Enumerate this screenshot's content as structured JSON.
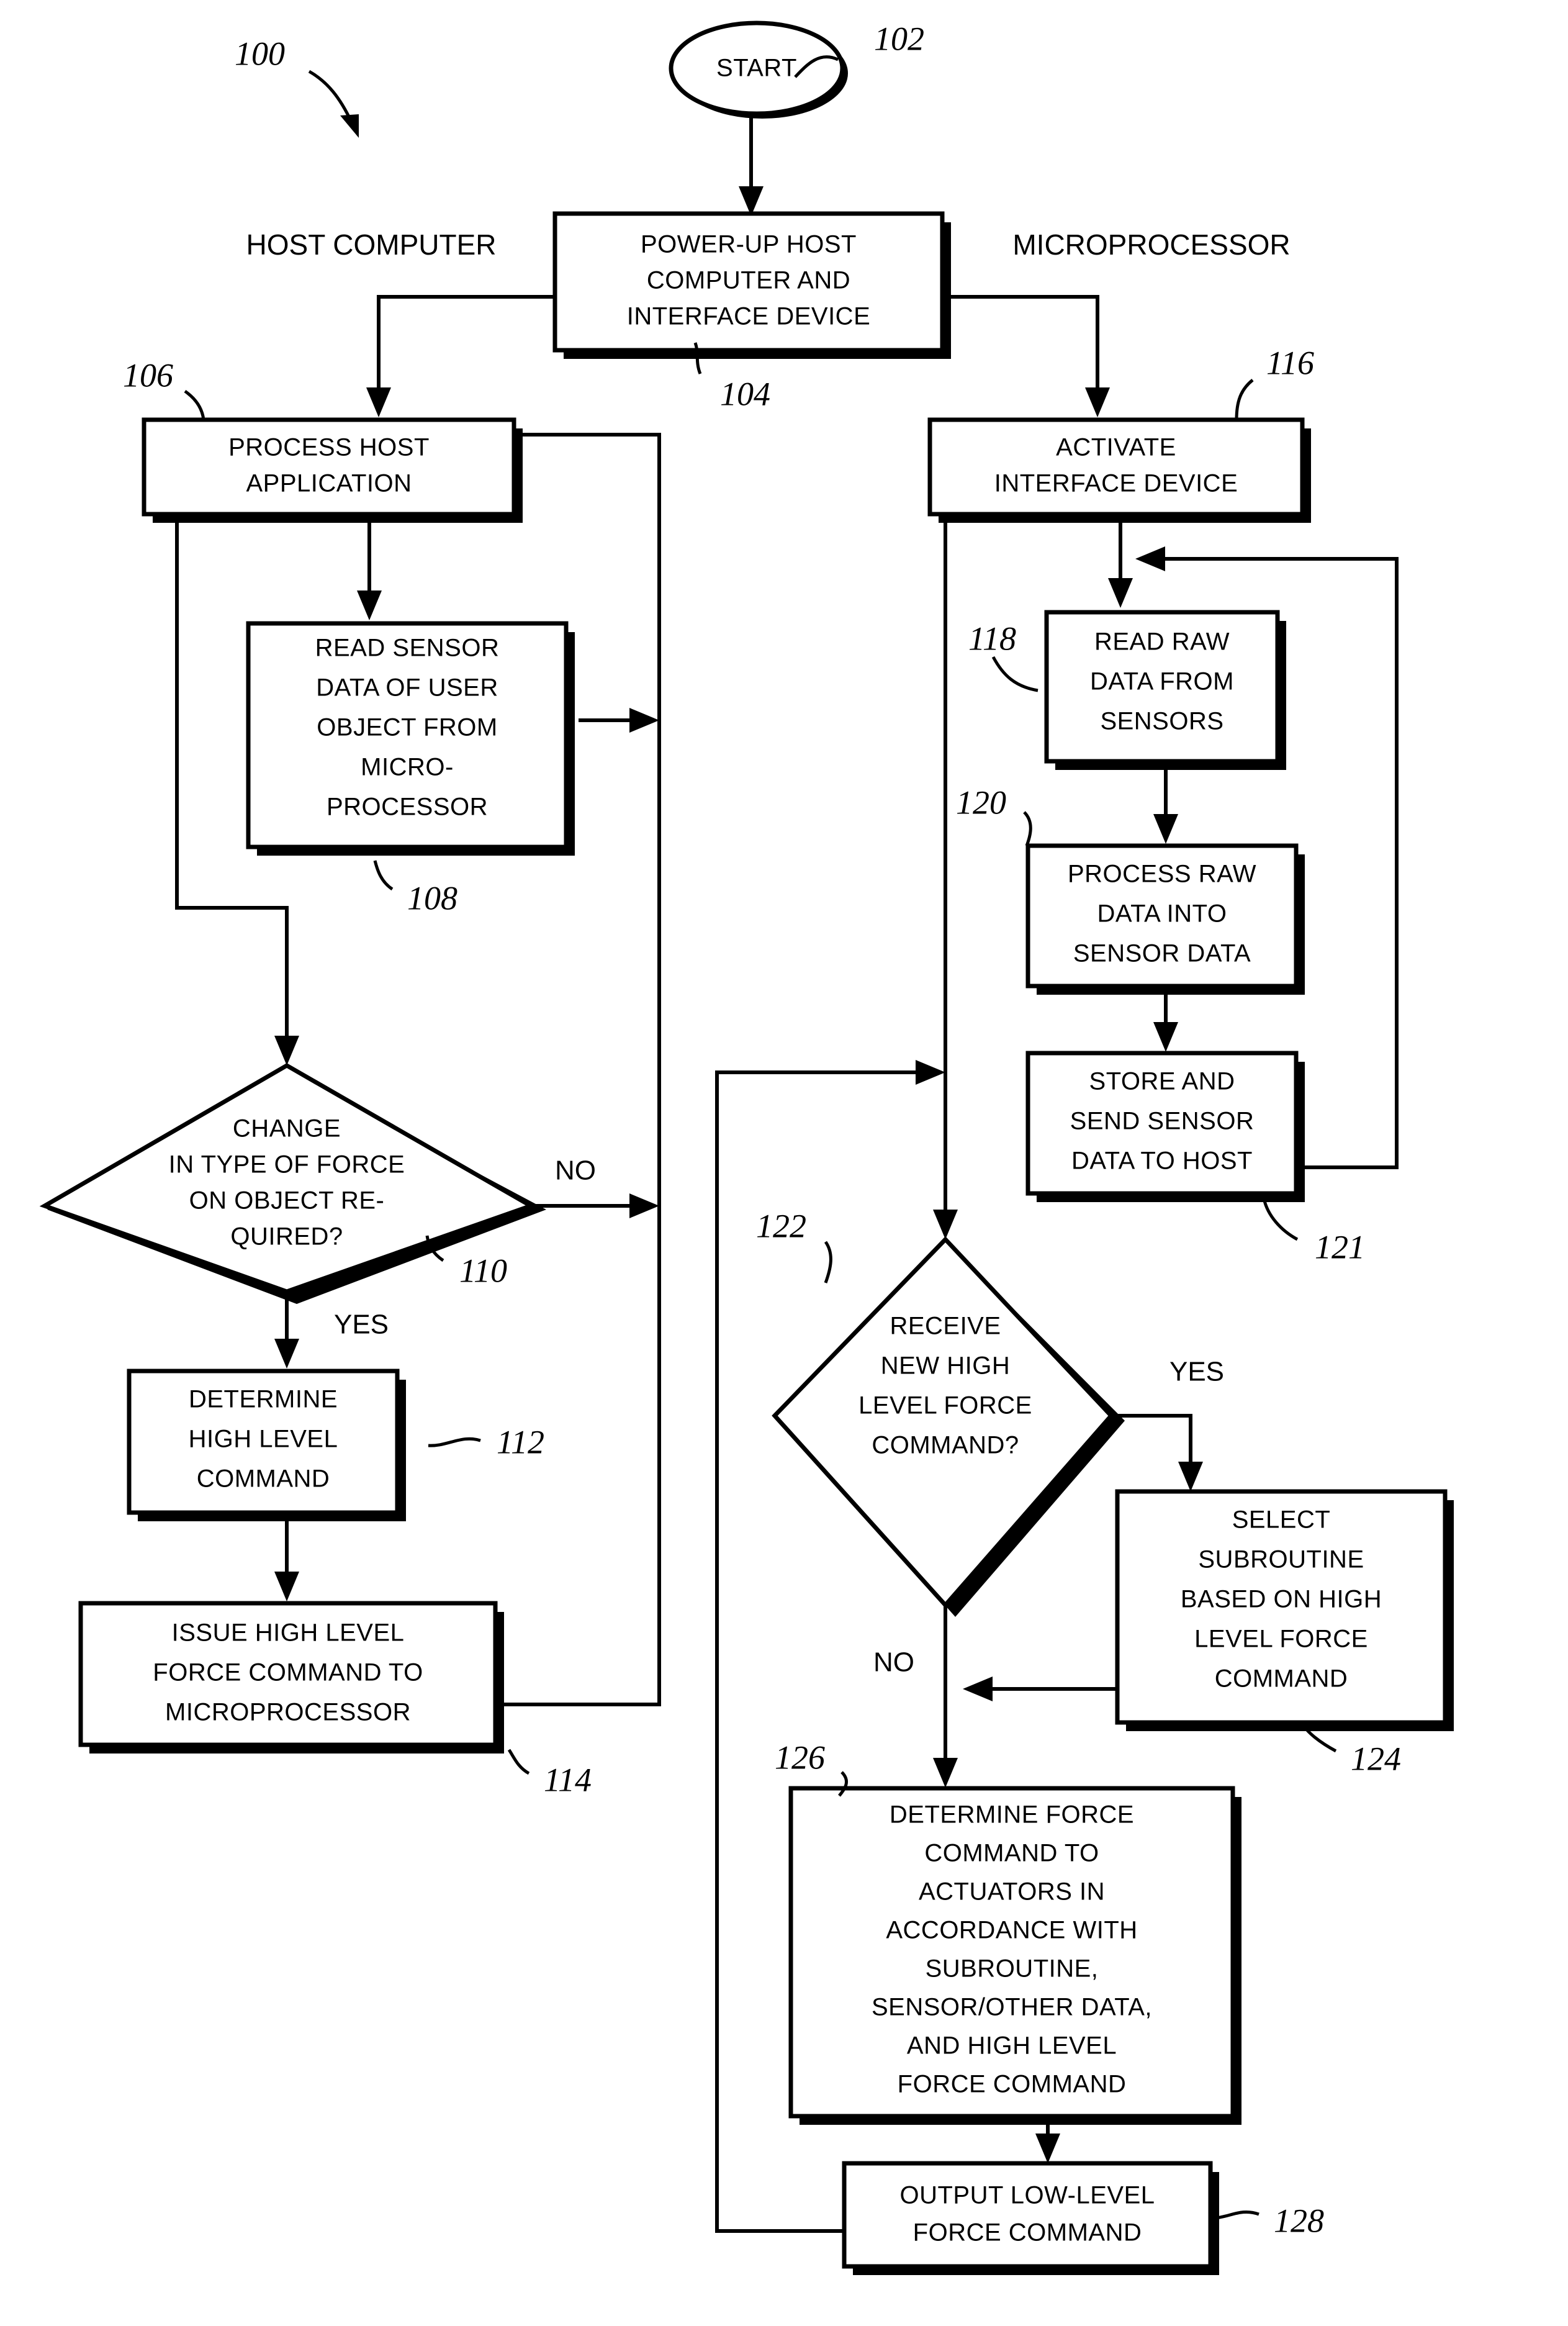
{
  "figure": {
    "reference_numeral": "100",
    "swimlanes": {
      "left_label": "HOST COMPUTER",
      "right_label": "MICROPROCESSOR"
    },
    "branch_labels": {
      "no": "NO",
      "yes": "YES"
    },
    "nodes": [
      {
        "id": "start",
        "ref": "102",
        "shape": "oval",
        "lines": [
          "START"
        ]
      },
      {
        "id": "powerup",
        "ref": "104",
        "shape": "process",
        "lines": [
          "POWER-UP HOST",
          "COMPUTER AND",
          "INTERFACE DEVICE"
        ]
      },
      {
        "id": "process-host-application",
        "ref": "106",
        "shape": "process",
        "lines": [
          "PROCESS HOST",
          "APPLICATION"
        ]
      },
      {
        "id": "read-sensor-data",
        "ref": "108",
        "shape": "process",
        "lines": [
          "READ SENSOR",
          "DATA OF USER",
          "OBJECT FROM",
          "MICRO-",
          "PROCESSOR"
        ]
      },
      {
        "id": "change-in-type-of-force",
        "ref": "110",
        "shape": "decision",
        "lines": [
          "CHANGE",
          "IN TYPE OF FORCE",
          "ON OBJECT RE-",
          "QUIRED?"
        ]
      },
      {
        "id": "determine-high-level-command",
        "ref": "112",
        "shape": "process",
        "lines": [
          "DETERMINE",
          "HIGH LEVEL",
          "COMMAND"
        ]
      },
      {
        "id": "issue-high-level-force-command",
        "ref": "114",
        "shape": "process",
        "lines": [
          "ISSUE HIGH LEVEL",
          "FORCE COMMAND TO",
          "MICROPROCESSOR"
        ]
      },
      {
        "id": "activate-interface-device",
        "ref": "116",
        "shape": "process",
        "lines": [
          "ACTIVATE",
          "INTERFACE DEVICE"
        ]
      },
      {
        "id": "read-raw-data",
        "ref": "118",
        "shape": "process",
        "lines": [
          "READ RAW",
          "DATA FROM",
          "SENSORS"
        ]
      },
      {
        "id": "process-raw-data",
        "ref": "120",
        "shape": "process",
        "lines": [
          "PROCESS RAW",
          "DATA INTO",
          "SENSOR DATA"
        ]
      },
      {
        "id": "store-and-send-sensor-data",
        "ref": "121",
        "shape": "process",
        "lines": [
          "STORE AND",
          "SEND SENSOR",
          "DATA TO HOST"
        ]
      },
      {
        "id": "receive-new-high-level-force-command",
        "ref": "122",
        "shape": "decision",
        "lines": [
          "RECEIVE",
          "NEW HIGH",
          "LEVEL FORCE",
          "COMMAND?"
        ]
      },
      {
        "id": "select-subroutine",
        "ref": "124",
        "shape": "process",
        "lines": [
          "SELECT",
          "SUBROUTINE",
          "BASED ON HIGH",
          "LEVEL FORCE",
          "COMMAND"
        ]
      },
      {
        "id": "determine-force-command",
        "ref": "126",
        "shape": "process",
        "lines": [
          "DETERMINE FORCE",
          "COMMAND TO",
          "ACTUATORS IN",
          "ACCORDANCE WITH",
          "SUBROUTINE,",
          "SENSOR/OTHER DATA,",
          "AND HIGH LEVEL",
          "FORCE COMMAND"
        ]
      },
      {
        "id": "output-low-level-force-command",
        "ref": "128",
        "shape": "process",
        "lines": [
          "OUTPUT LOW-LEVEL",
          "FORCE COMMAND"
        ]
      }
    ]
  }
}
